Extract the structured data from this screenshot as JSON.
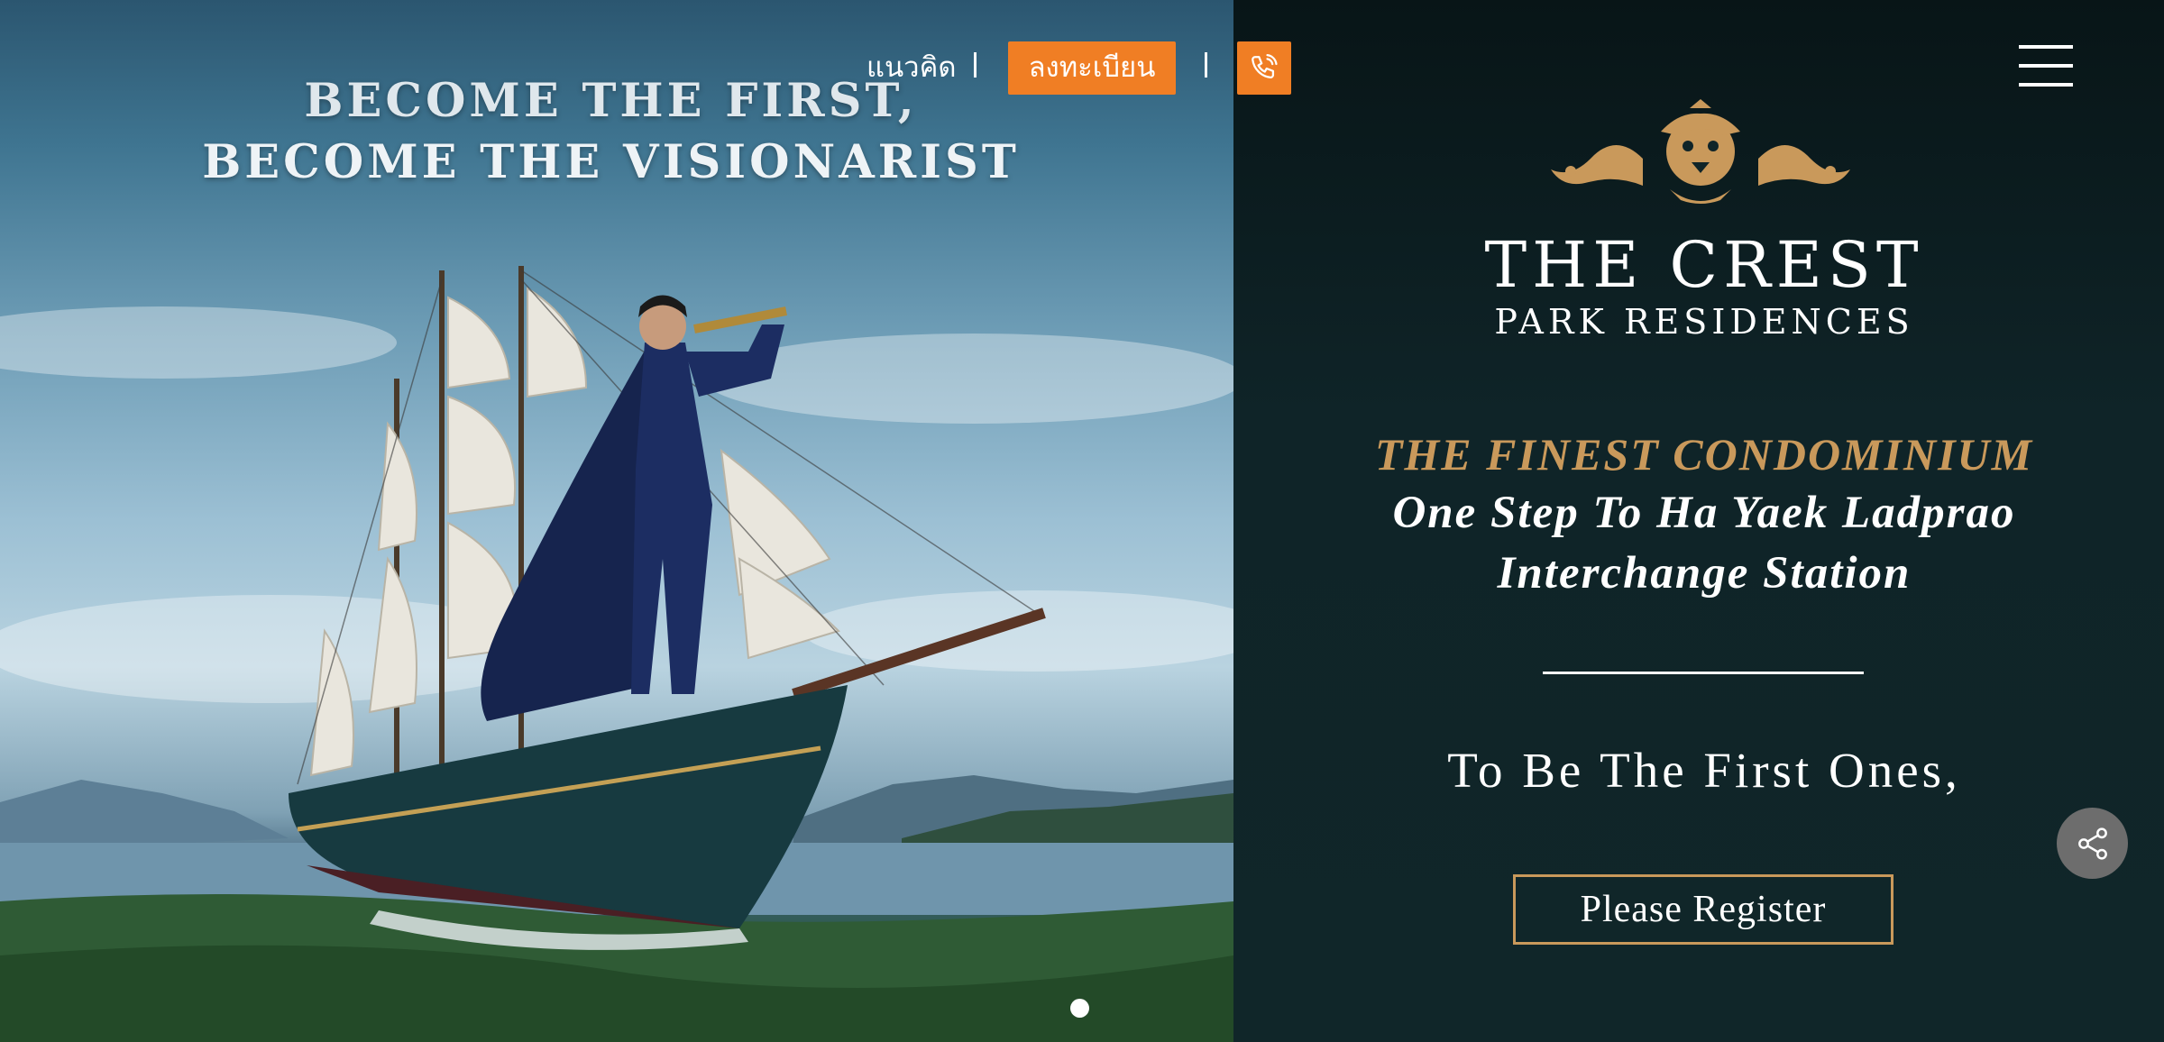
{
  "hero": {
    "headline_line1": "BECOME THE FIRST,",
    "headline_line2": "BECOME THE VISIONARIST",
    "image_alt": "Man in navy suit with spyglass standing on the bow of a tall sailing ship on grassy hills",
    "slide_indicator": {
      "active": 1,
      "total": 1
    }
  },
  "topnav": {
    "concept_label": "แนวคิด",
    "register_label": "ลงทะเบียน",
    "phone_icon": "phone-icon",
    "accent_color": "#f07e24"
  },
  "panel": {
    "logo_icon": "lion-crest-icon",
    "brand_name": "THE CREST",
    "brand_sub": "PARK RESIDENCES",
    "tag_gold": "THE FINEST CONDOMINIUM",
    "tag_line2": "One Step To Ha Yaek Ladprao",
    "tag_line3": "Interchange Station",
    "tagline": "To Be The First Ones,",
    "cta_label": "Please Register",
    "gold_color": "#c9995b",
    "background_color": "#0f2428"
  },
  "floating": {
    "menu_icon": "hamburger-menu-icon",
    "share_icon": "share-icon"
  }
}
